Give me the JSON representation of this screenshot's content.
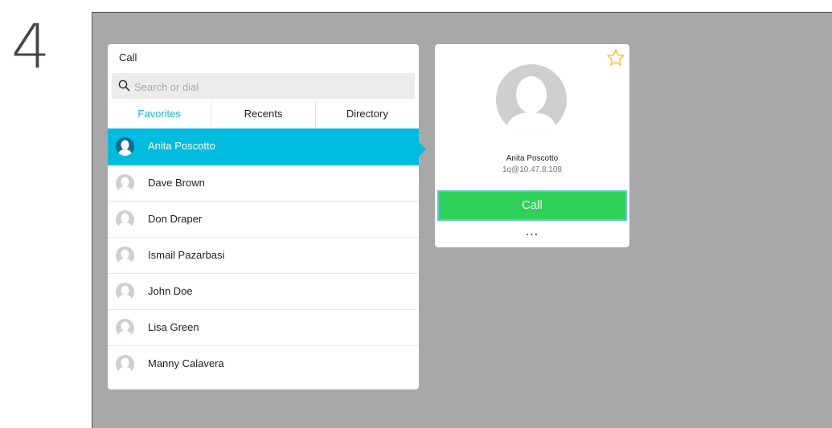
{
  "step_number": "4",
  "call_panel": {
    "title": "Call",
    "search": {
      "placeholder": "Search or dial",
      "value": ""
    },
    "tabs": [
      {
        "label": "Favorites",
        "active": true
      },
      {
        "label": "Recents",
        "active": false
      },
      {
        "label": "Directory",
        "active": false
      }
    ],
    "contacts": [
      {
        "name": "Anita Poscotto",
        "selected": true
      },
      {
        "name": "Dave Brown"
      },
      {
        "name": "Don Draper"
      },
      {
        "name": "Ismail Pazarbasi"
      },
      {
        "name": "John Doe"
      },
      {
        "name": "Lisa Green"
      },
      {
        "name": "Manny Calavera"
      }
    ]
  },
  "detail_card": {
    "name": "Anita Poscotto",
    "address": "1q@10.47.8.108",
    "call_label": "Call",
    "more_label": "...",
    "favorite_icon": "star-outline-icon"
  },
  "colors": {
    "accent": "#00bcdf",
    "active_tab": "#19b5da",
    "call_green": "#30d158",
    "screen_bg": "#a8a8a8",
    "star": "#f5b800"
  }
}
